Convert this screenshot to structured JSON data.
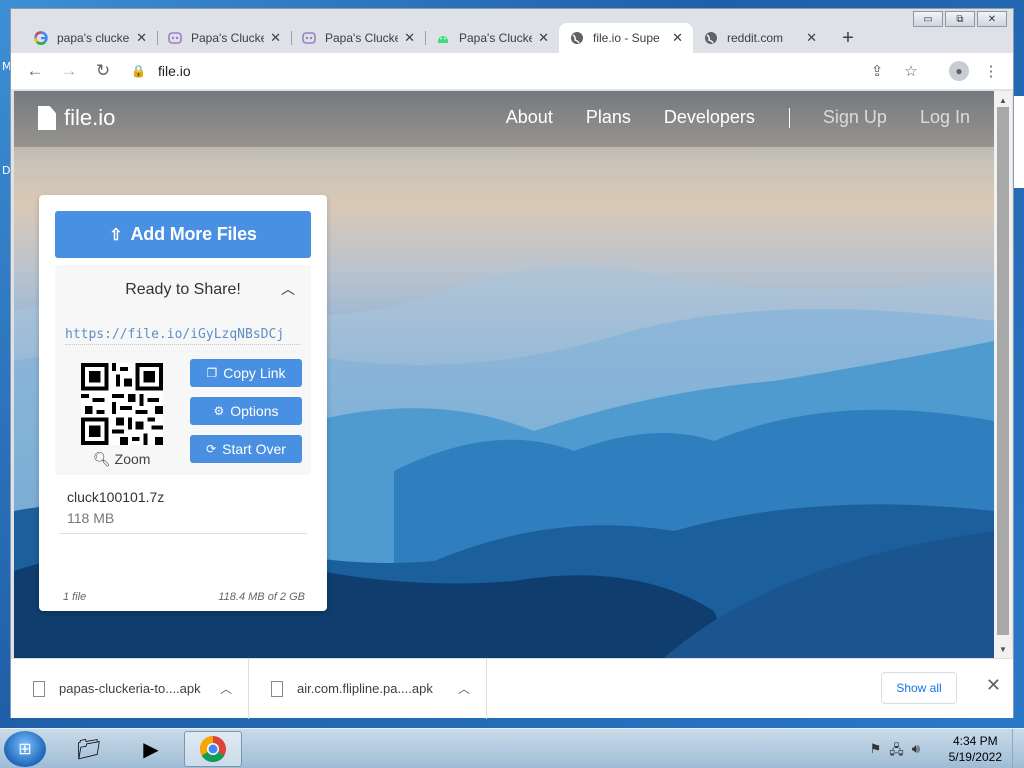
{
  "browser": {
    "tabs": [
      {
        "title": "papa's clucke",
        "favicon": "google-icon",
        "active": false
      },
      {
        "title": "Papa's Clucke",
        "favicon": "app-icon",
        "active": false
      },
      {
        "title": "Papa's Clucke",
        "favicon": "app-icon",
        "active": false
      },
      {
        "title": "Papa's Clucke",
        "favicon": "android-icon",
        "active": false
      },
      {
        "title": "file.io - Supe",
        "favicon": "globe-icon",
        "active": true
      },
      {
        "title": "reddit.com",
        "favicon": "globe-icon",
        "active": false
      }
    ],
    "url": "file.io",
    "window_controls": {
      "minimize": "▭",
      "restore": "⧉",
      "close": "✕"
    }
  },
  "site": {
    "logo": "file.io",
    "nav": [
      "About",
      "Plans",
      "Developers"
    ],
    "nav_auth": [
      "Sign Up",
      "Log In"
    ]
  },
  "card": {
    "add_button": "Add More Files",
    "ready_text": "Ready to Share!",
    "link": "https://file.io/iGyLzqNBsDCj",
    "zoom": "Zoom",
    "actions": {
      "copy": "Copy Link",
      "options": "Options",
      "start_over": "Start Over"
    },
    "file": {
      "name": "cluck100101.7z",
      "size": "118 MB"
    },
    "footer": {
      "count": "1 file",
      "usage": "118.4 MB of 2 GB"
    }
  },
  "downloads": {
    "items": [
      "papas-cluckeria-to....apk",
      "air.com.flipline.pa....apk"
    ],
    "show_all": "Show all"
  },
  "taskbar": {
    "time": "4:34 PM",
    "date": "5/19/2022"
  },
  "colors": {
    "accent": "#4a90e2",
    "link": "#5b8fc7"
  }
}
